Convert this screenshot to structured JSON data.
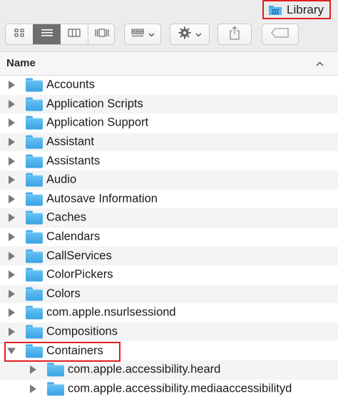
{
  "window": {
    "title": "Library",
    "title_icon": "library-folder-icon"
  },
  "toolbar": {
    "view_buttons": [
      {
        "name": "icon-view",
        "icon": "grid-icon"
      },
      {
        "name": "list-view",
        "icon": "list-icon",
        "active": true
      },
      {
        "name": "column-view",
        "icon": "columns-icon"
      },
      {
        "name": "gallery-view",
        "icon": "coverflow-icon"
      }
    ],
    "arrange_icon": "arrange-icon",
    "action_icon": "gear-icon",
    "share_icon": "share-icon",
    "tag_icon": "tag-icon",
    "chevron": "⌄"
  },
  "columns": {
    "name_header": "Name",
    "sort_indicator": "^"
  },
  "items": [
    {
      "label": "Accounts",
      "level": 0,
      "expanded": false
    },
    {
      "label": "Application Scripts",
      "level": 0,
      "expanded": false
    },
    {
      "label": "Application Support",
      "level": 0,
      "expanded": false
    },
    {
      "label": "Assistant",
      "level": 0,
      "expanded": false
    },
    {
      "label": "Assistants",
      "level": 0,
      "expanded": false
    },
    {
      "label": "Audio",
      "level": 0,
      "expanded": false
    },
    {
      "label": "Autosave Information",
      "level": 0,
      "expanded": false
    },
    {
      "label": "Caches",
      "level": 0,
      "expanded": false
    },
    {
      "label": "Calendars",
      "level": 0,
      "expanded": false
    },
    {
      "label": "CallServices",
      "level": 0,
      "expanded": false
    },
    {
      "label": "ColorPickers",
      "level": 0,
      "expanded": false
    },
    {
      "label": "Colors",
      "level": 0,
      "expanded": false
    },
    {
      "label": "com.apple.nsurlsessiond",
      "level": 0,
      "expanded": false
    },
    {
      "label": "Compositions",
      "level": 0,
      "expanded": false
    },
    {
      "label": "Containers",
      "level": 0,
      "expanded": true,
      "highlighted": true
    },
    {
      "label": "com.apple.accessibility.heard",
      "level": 1,
      "expanded": false
    },
    {
      "label": "com.apple.accessibility.mediaaccessibilityd",
      "level": 1,
      "expanded": false
    }
  ],
  "colors": {
    "folder_blue": "#3aa3e3",
    "highlight_red": "#e02020"
  }
}
